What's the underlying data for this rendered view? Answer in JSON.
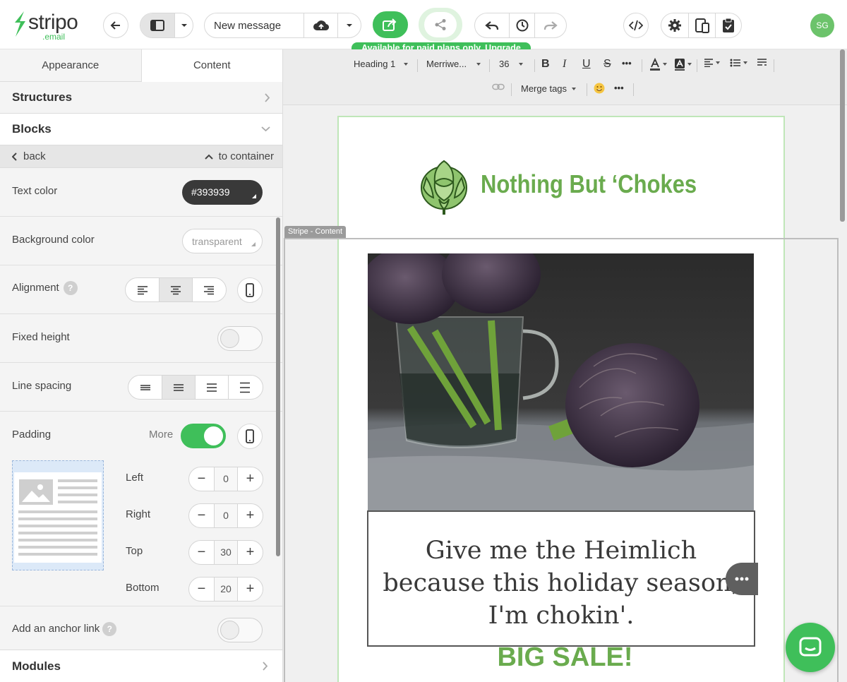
{
  "header": {
    "logo_word": "stripo",
    "logo_sub": ".email",
    "message_name": "New message",
    "paid_notice": "Available for paid plans only.",
    "upgrade_link": "Upgrade",
    "avatar_initials": "SG",
    "accent_color": "#3fbf5a"
  },
  "sidebar": {
    "tabs": [
      "Appearance",
      "Content"
    ],
    "active_tab": "Content",
    "structures": "Structures",
    "blocks": "Blocks",
    "back": "back",
    "to_container": "to container",
    "text_color_label": "Text color",
    "text_color_value": "#393939",
    "bg_color_label": "Background color",
    "bg_color_value": "transparent",
    "alignment_label": "Alignment",
    "alignment_help": "?",
    "fixed_height_label": "Fixed height",
    "line_spacing_label": "Line spacing",
    "padding_label": "Padding",
    "padding_more": "More",
    "padding": {
      "left_label": "Left",
      "left_value": "0",
      "right_label": "Right",
      "right_value": "0",
      "top_label": "Top",
      "top_value": "30",
      "bottom_label": "Bottom",
      "bottom_value": "20"
    },
    "anchor_label": "Add an anchor link",
    "anchor_help": "?",
    "modules": "Modules"
  },
  "format_toolbar": {
    "heading": "Heading 1",
    "font": "Merriwe...",
    "size": "36",
    "merge_tags": "Merge tags",
    "bold": "B",
    "italic": "I",
    "underline": "U",
    "strike": "S",
    "more": "•••"
  },
  "email": {
    "brand_name": "Nothing But ‘Chokes",
    "stripe_tag": "Stripe - Content",
    "headline_line1": "Give me the Heimlich",
    "headline_line2": "because this holiday season,",
    "headline_line3": "I'm chokin'.",
    "sale_text": "BIG SALE!",
    "brand_color": "#6aab4e",
    "text_color": "#393939"
  }
}
